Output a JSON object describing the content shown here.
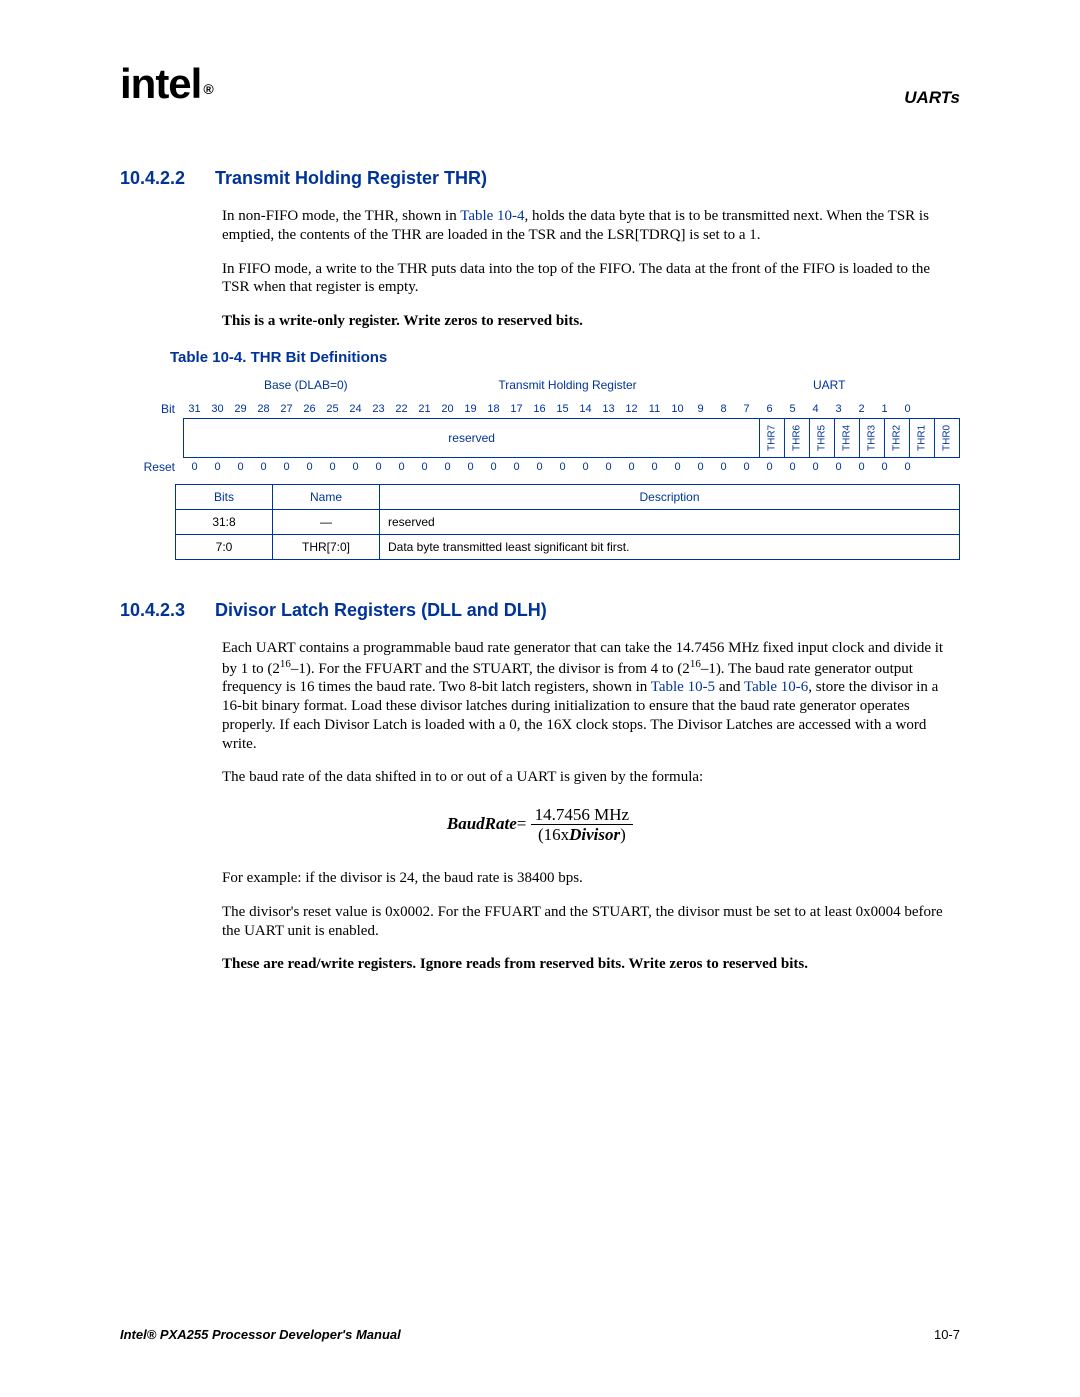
{
  "header": {
    "logo_text": "intel",
    "logo_reg": "®",
    "chapter": "UARTs"
  },
  "section1": {
    "number": "10.4.2.2",
    "title": "Transmit Holding Register THR)",
    "para1_a": "In non-FIFO mode, the THR, shown in ",
    "para1_link": "Table 10-4",
    "para1_b": ", holds the data byte that is to be transmitted next. When the TSR is emptied, the contents of the THR are loaded in the TSR and the LSR[TDRQ] is set to a 1.",
    "para2": "In FIFO mode, a write to the THR puts data into the top of the FIFO. The data at the front of the FIFO is loaded to the TSR when that register is empty.",
    "note": "This is a write-only register. Write zeros to reserved bits."
  },
  "table": {
    "caption": "Table 10-4. THR Bit Definitions",
    "hdr_left": "Base (DLAB=0)",
    "hdr_mid": "Transmit Holding Register",
    "hdr_right": "UART",
    "bit_label": "Bit",
    "reset_label": "Reset",
    "bit_numbers": [
      "31",
      "30",
      "29",
      "28",
      "27",
      "26",
      "25",
      "24",
      "23",
      "22",
      "21",
      "20",
      "19",
      "18",
      "17",
      "16",
      "15",
      "14",
      "13",
      "12",
      "11",
      "10",
      "9",
      "8",
      "7",
      "6",
      "5",
      "4",
      "3",
      "2",
      "1",
      "0"
    ],
    "reserved_label": "reserved",
    "thr_fields": [
      "THR7",
      "THR6",
      "THR5",
      "THR4",
      "THR3",
      "THR2",
      "THR1",
      "THR0"
    ],
    "reset_values": [
      "0",
      "0",
      "0",
      "0",
      "0",
      "0",
      "0",
      "0",
      "0",
      "0",
      "0",
      "0",
      "0",
      "0",
      "0",
      "0",
      "0",
      "0",
      "0",
      "0",
      "0",
      "0",
      "0",
      "0",
      "0",
      "0",
      "0",
      "0",
      "0",
      "0",
      "0",
      "0"
    ],
    "desc_hdr_bits": "Bits",
    "desc_hdr_name": "Name",
    "desc_hdr_desc": "Description",
    "desc_rows": [
      {
        "bits": "31:8",
        "name": "—",
        "desc": "reserved"
      },
      {
        "bits": "7:0",
        "name": "THR[7:0]",
        "desc": "Data byte transmitted least significant bit first."
      }
    ]
  },
  "section2": {
    "number": "10.4.2.3",
    "title": "Divisor Latch Registers (DLL and DLH)",
    "para1_a": "Each UART contains a programmable baud rate generator that can take the 14.7456 MHz fixed input clock and divide it by 1 to (2",
    "para1_sup1": "16",
    "para1_b": "–1). For the FFUART and the STUART, the divisor is from 4 to (2",
    "para1_sup2": "16",
    "para1_c": "–1). The baud rate generator output frequency is 16 times the baud rate. Two 8-bit latch registers, shown in ",
    "para1_link1": "Table 10-5",
    "para1_d": " and ",
    "para1_link2": "Table 10-6",
    "para1_e": ", store the divisor in a 16-bit binary format. Load these divisor latches during initialization to ensure that the baud rate generator operates properly. If each Divisor Latch is loaded with a 0, the 16X clock stops. The Divisor Latches are accessed with a word write.",
    "para2": "The baud rate of the data shifted in to or out of a UART is given by the formula:",
    "formula_lhs": "BaudRate",
    "formula_eq": "=",
    "formula_num": "14.7456 MHz",
    "formula_den_a": "(16x",
    "formula_den_b": "Divisor",
    "formula_den_c": ")",
    "para3": "For example: if the divisor is 24, the baud rate is 38400 bps.",
    "para4": "The divisor's reset value is 0x0002. For the FFUART and the STUART, the divisor must be set to at least 0x0004 before the UART unit is enabled.",
    "note": "These are read/write registers. Ignore reads from reserved bits. Write zeros to reserved bits."
  },
  "footer": {
    "title": "Intel® PXA255 Processor Developer's Manual",
    "page": "10-7"
  }
}
